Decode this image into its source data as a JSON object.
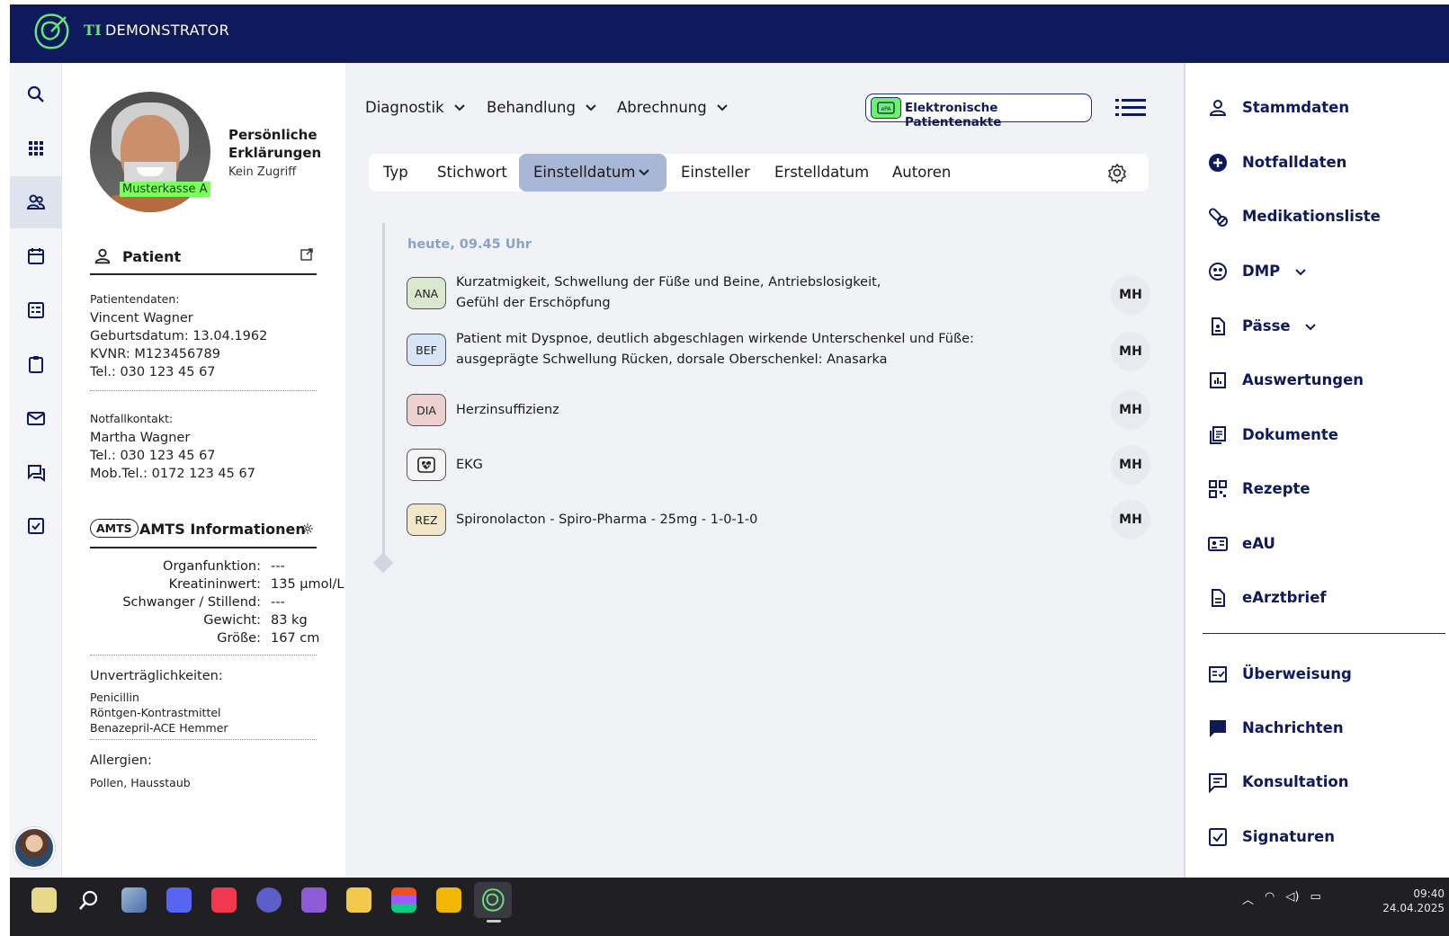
{
  "app": {
    "title_prefix": "TI",
    "title_rest": "DEMONSTRATOR"
  },
  "rail": {
    "items": [
      "search-icon",
      "apps-grid-icon",
      "patients-icon",
      "calendar-icon",
      "list-card-icon",
      "clipboard-icon",
      "mail-icon",
      "chat-icon",
      "checkbox-icon"
    ],
    "active_index": 2
  },
  "patient": {
    "insurance": "Musterkasse A",
    "personal_title": "Persönliche Erklärungen",
    "personal_status": "Kein Zugriff",
    "section_title": "Patient",
    "data_label": "Patientendaten:",
    "name": "Vincent Wagner",
    "birthdate": "Geburtsdatum: 13.04.1962",
    "kvnr": "KVNR: M123456789",
    "phone": "Tel.: 030 123 45 67",
    "emergency_label": "Notfallkontakt:",
    "emergency_name": "Martha Wagner",
    "emergency_phone": "Tel.: 030 123 45 67",
    "emergency_mobile": "Mob.Tel.: 0172 123 45 67"
  },
  "amts": {
    "badge": "AMTS",
    "title": "AMTS Informationen",
    "rows": [
      {
        "key": "Organfunktion:",
        "value": "---"
      },
      {
        "key": "Kreatininwert:",
        "value": "135 µmol/L"
      },
      {
        "key": "Schwanger / Stillend:",
        "value": "---"
      },
      {
        "key": "Gewicht:",
        "value": "83 kg"
      },
      {
        "key": "Größe:",
        "value": "167 cm"
      }
    ],
    "intolerances_label": "Unverträglichkeiten:",
    "intolerances": [
      "Penicillin",
      "Röntgen-Kontrastmittel",
      "Benazepril-ACE Hemmer"
    ],
    "allergies_label": "Allergien:",
    "allergies": "Pollen, Hausstaub"
  },
  "menu": {
    "diagnostik": "Diagnostik",
    "behandlung": "Behandlung",
    "abrechnung": "Abrechnung",
    "epa_icon_text": "ePA",
    "epa_label": "Elektronische Patientenakte"
  },
  "filters": {
    "typ": "Typ",
    "stichwort": "Stichwort",
    "einstelldatum": "Einstelldatum",
    "einsteller": "Einsteller",
    "erstelldatum": "Erstelldatum",
    "autoren": "Autoren"
  },
  "timeline": {
    "date": "heute, 09.45 Uhr",
    "entries": [
      {
        "badge": "ANA",
        "line1": "Kurzatmigkeit, Schwellung der Füße und Beine, Antriebslosigkeit,",
        "line2": "Gefühl der Erschöpfung",
        "author": "MH",
        "color": "#dbe7cf"
      },
      {
        "badge": "BEF",
        "line1": "Patient mit Dyspnoe, deutlich abgeschlagen wirkende Unterschenkel und Füße:",
        "line2": "ausgeprägte Schwellung Rücken, dorsale Oberschenkel: Anasarka",
        "author": "MH",
        "color": "#d7e4f3"
      },
      {
        "badge": "DIA",
        "line1": "Herzinsuffizienz",
        "line2": "",
        "author": "MH",
        "color": "#ecd0d0"
      },
      {
        "badge": "",
        "line1": "EKG",
        "line2": "",
        "author": "MH",
        "color": "#f4f4f4"
      },
      {
        "badge": "REZ",
        "line1": "Spironolacton - Spiro-Pharma - 25mg - 1-0-1-0",
        "line2": "",
        "author": "MH",
        "color": "#f1e6c8"
      }
    ]
  },
  "rightbar": {
    "items": [
      "Stammdaten",
      "Notfalldaten",
      "Medikationsliste",
      "DMP",
      "Pässe",
      "Auswertungen",
      "Dokumente",
      "Rezepte",
      "eAU",
      "eArztbrief",
      "Überweisung",
      "Nachrichten",
      "Konsultation",
      "Signaturen"
    ]
  },
  "taskbar": {
    "time": "09:40",
    "date": "24.04.2025"
  },
  "colors": {
    "topbar": "#0e1a5c",
    "accent_green": "#6ee07a",
    "filter_active": "#a9b7d6",
    "nav_text": "#0e1a5c"
  }
}
